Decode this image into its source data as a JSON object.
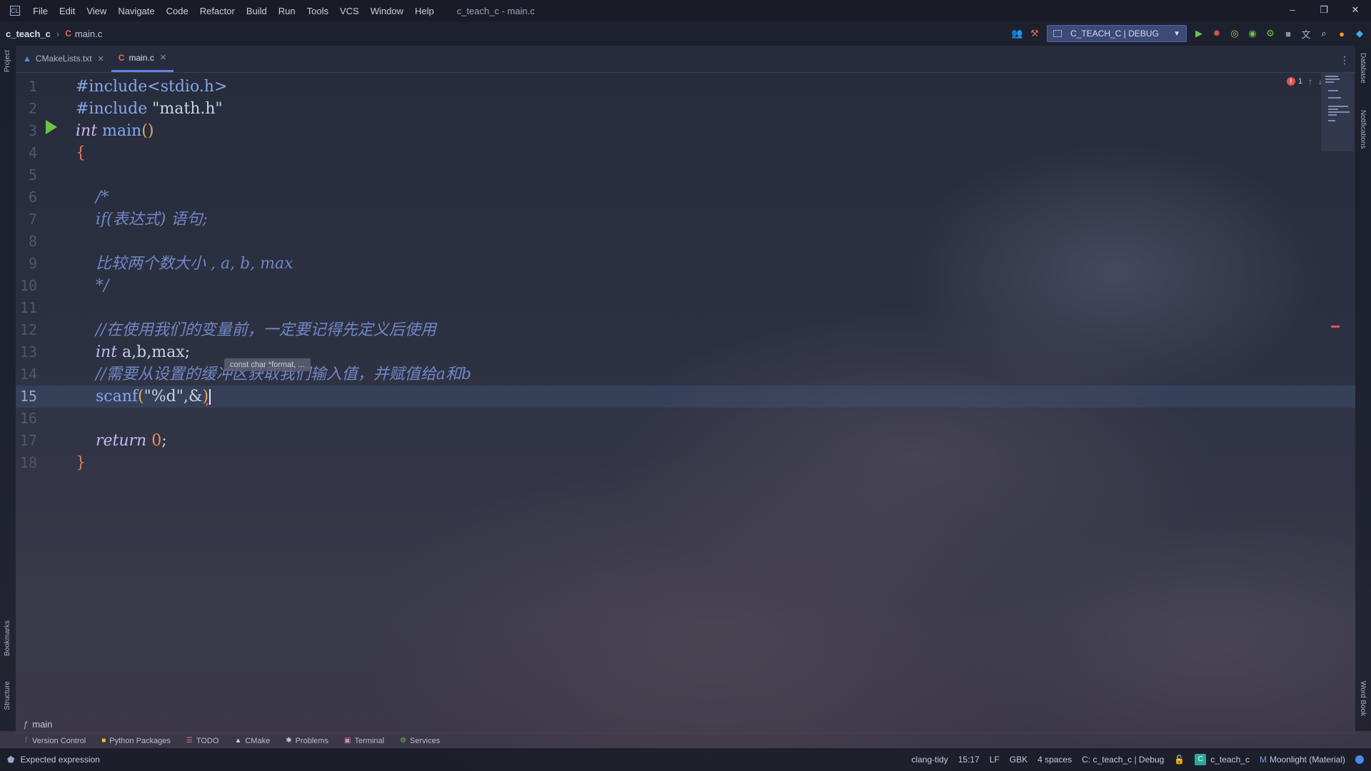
{
  "menubar": {
    "items": [
      "File",
      "Edit",
      "View",
      "Navigate",
      "Code",
      "Refactor",
      "Build",
      "Run",
      "Tools",
      "VCS",
      "Window",
      "Help"
    ],
    "window_title": "c_teach_c - main.c",
    "minimize": "–",
    "maximize": "❐",
    "close": "✕"
  },
  "navbar": {
    "project": "c_teach_c",
    "file": "main.c",
    "run_config": "C_TEACH_C | DEBUG"
  },
  "tabs": [
    {
      "label": "CMakeLists.txt",
      "icon": "cmake-icon",
      "active": false
    },
    {
      "label": "main.c",
      "icon": "c-file-icon",
      "active": true
    }
  ],
  "editor": {
    "line_numbers": [
      "1",
      "2",
      "3",
      "4",
      "5",
      "6",
      "7",
      "8",
      "9",
      "10",
      "11",
      "12",
      "13",
      "14",
      "15",
      "16",
      "17",
      "18"
    ],
    "current_line": 15,
    "param_hint": "const char *format, ...",
    "error_count": "1"
  },
  "code": {
    "l1": "#include<stdio.h>",
    "l2a": "#include ",
    "l2b": "\"math.h\"",
    "l3_kw": "int",
    "l3_fn": "main",
    "l3_paren": "()",
    "l4": "{",
    "l6": "/*",
    "l7": "if(表达式) 语句;",
    "l9": "比较两个数大小 , a, b, max",
    "l10": "*/",
    "l12": "//在使用我们的变量前，一定要记得先定义后使用",
    "l13_kw": "int",
    "l13_rest": " a,b,max;",
    "l14": "//需要从设置的缓冲区获取我们输入值，并赋值给a和b",
    "l15_fn": "scanf",
    "l15_open": "(",
    "l15_str": "\"%d\",&",
    "l15_close": ")",
    "l17_kw": "return",
    "l17_num": " 0",
    "l17_end": ";",
    "l18": "}"
  },
  "func_crumb": "main",
  "left_strip": {
    "project": "Project",
    "bookmarks": "Bookmarks",
    "structure": "Structure"
  },
  "right_strip": {
    "database": "Database",
    "notifications": "Notifications",
    "wordbook": "Word Book"
  },
  "toolwindows": [
    "Version Control",
    "Python Packages",
    "TODO",
    "CMake",
    "Problems",
    "Terminal",
    "Services"
  ],
  "statusbar": {
    "message": "Expected expression",
    "clang_tidy": "clang-tidy",
    "position": "15:17",
    "line_sep": "LF",
    "encoding": "GBK",
    "indent": "4 spaces",
    "context": "C: c_teach_c | Debug",
    "project": "c_teach_c",
    "theme": "Moonlight (Material)"
  },
  "colors": {
    "accent": "#5d86e0",
    "error": "#e05252",
    "run": "#6cc24a"
  }
}
